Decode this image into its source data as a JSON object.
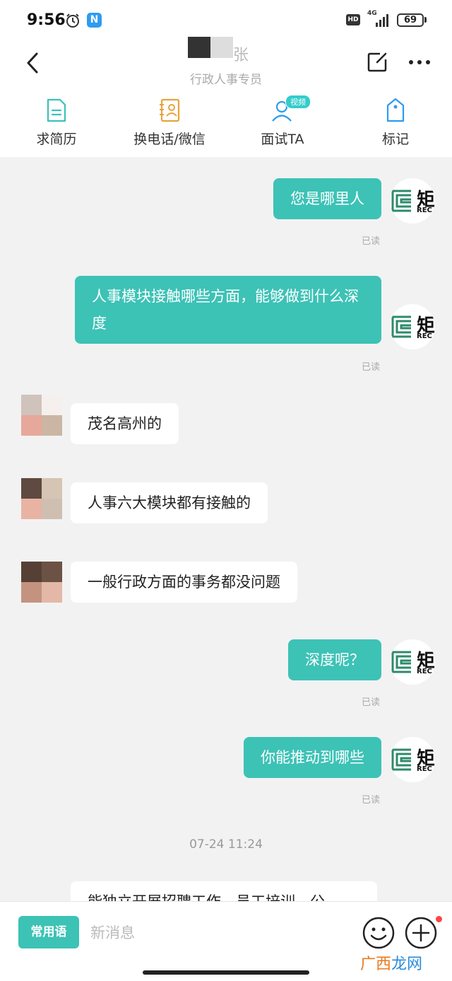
{
  "status_bar": {
    "time": "9:56",
    "app_badge": "N",
    "hd": "HD",
    "network": "4G",
    "battery": "69"
  },
  "header": {
    "title": "张",
    "subtitle": "行政人事专员"
  },
  "actions": [
    {
      "label": "求简历",
      "icon": "resume-icon"
    },
    {
      "label": "换电话/微信",
      "icon": "contact-card-icon"
    },
    {
      "label": "面试TA",
      "icon": "interview-icon",
      "badge": "视频"
    },
    {
      "label": "标记",
      "icon": "tag-icon"
    }
  ],
  "avatar_logo": {
    "char": "矩",
    "sub": "REC"
  },
  "colors": {
    "accent": "#3dc2b6",
    "chat_bg": "#f2f2f2"
  },
  "messages": [
    {
      "from": "me",
      "text": "您是哪里人",
      "status": "已读"
    },
    {
      "from": "me",
      "text": "人事模块接触哪些方面，能够做到什么深度",
      "status": "已读"
    },
    {
      "from": "them",
      "text": "茂名高州的"
    },
    {
      "from": "them",
      "text": "人事六大模块都有接触的"
    },
    {
      "from": "them",
      "text": "一般行政方面的事务都没问题"
    },
    {
      "from": "me",
      "text": "深度呢？",
      "status": "已读"
    },
    {
      "from": "me",
      "text": "你能推动到哪些",
      "status": "已读"
    },
    {
      "from": "them",
      "text": "能独立开展招聘工作，员工培训，公"
    }
  ],
  "timestamp": "07-24 11:24",
  "input": {
    "phrase_button": "常用语",
    "placeholder": "新消息"
  },
  "watermark": {
    "part1": "广西",
    "part2": "龙网"
  }
}
